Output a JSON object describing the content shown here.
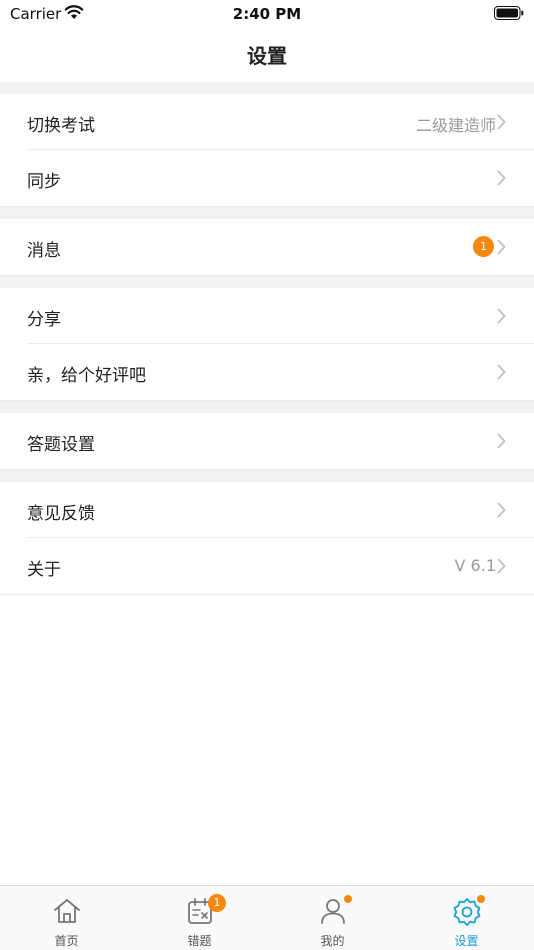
{
  "status_bar": {
    "carrier": "Carrier",
    "time": "2:40 PM"
  },
  "nav": {
    "title": "设置"
  },
  "settings": {
    "switch_exam": {
      "label": "切换考试",
      "value": "二级建造师"
    },
    "sync": {
      "label": "同步"
    },
    "messages": {
      "label": "消息",
      "badge": "1"
    },
    "share": {
      "label": "分享"
    },
    "rate": {
      "label": "亲，给个好评吧"
    },
    "answer_settings": {
      "label": "答题设置"
    },
    "feedback": {
      "label": "意见反馈"
    },
    "about": {
      "label": "关于",
      "value": "V 6.1"
    }
  },
  "tab_bar": {
    "home": {
      "label": "首页",
      "icon": "home-icon"
    },
    "mistakes": {
      "label": "错题",
      "icon": "calendar-x-icon",
      "badge": "1"
    },
    "mine": {
      "label": "我的",
      "icon": "person-icon"
    },
    "settings": {
      "label": "设置",
      "icon": "gear-icon",
      "active": true
    }
  },
  "colors": {
    "accent": "#1a9fd6",
    "badge": "#f5890f",
    "group_background": "#f2f2f4",
    "chevron": "#c4c4c4"
  }
}
